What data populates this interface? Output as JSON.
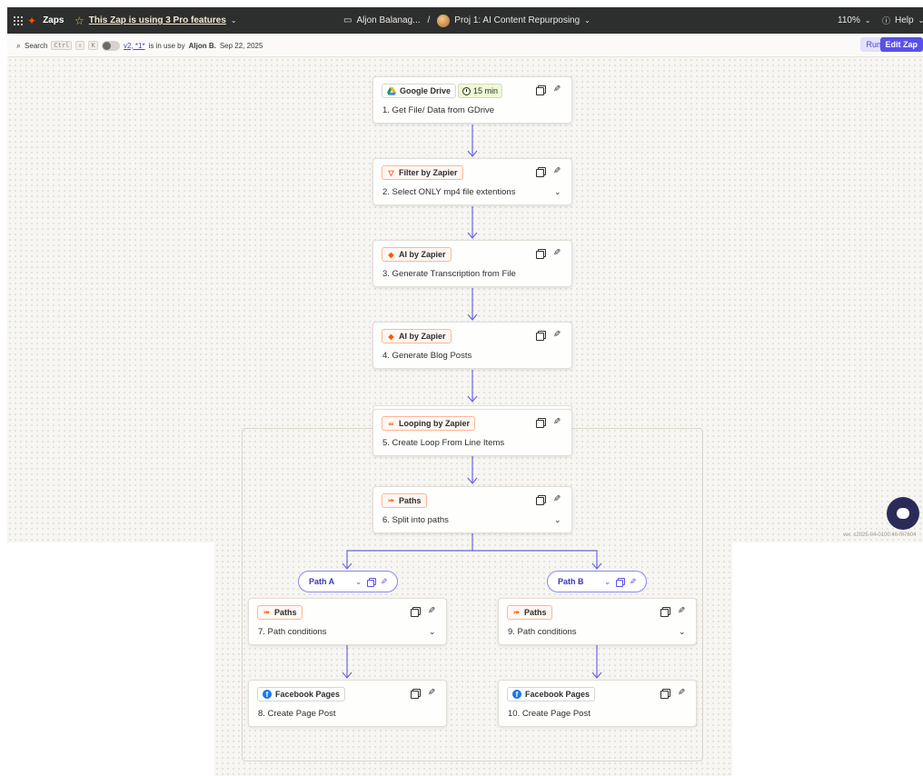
{
  "topbar": {
    "app_label": "Zaps",
    "pro_notice": "This Zap is using 3 Pro features",
    "folder": "Aljon Balanag...",
    "separator": "/",
    "zap_name": "Proj 1: AI Content Repurposing",
    "zoom": "110%",
    "help": "Help"
  },
  "subbar": {
    "search_label": "Search",
    "shortcut_ctrl": "Ctrl",
    "shortcut_shift": "⇧",
    "shortcut_key": "K",
    "version_link": "v2, *1*",
    "in_use_text": "is in use by",
    "user": "Aljon B.",
    "date": "Sep 22, 2025",
    "run_label": "Run",
    "edit_label": "Edit Zap"
  },
  "steps": [
    {
      "app": "Google Drive",
      "title": "1. Get File/ Data from GDrive",
      "badge": "15 min",
      "icon": "google-drive-icon"
    },
    {
      "app": "Filter by Zapier",
      "title": "2. Select ONLY mp4 file extentions",
      "icon": "filter-icon",
      "expandable": true
    },
    {
      "app": "AI by Zapier",
      "title": "3. Generate Transcription from File",
      "icon": "ai-sparkle-icon"
    },
    {
      "app": "AI by Zapier",
      "title": "4. Generate Blog Posts",
      "icon": "ai-sparkle-icon"
    },
    {
      "app": "Looping by Zapier",
      "title": "5. Create Loop From Line Items",
      "icon": "loop-icon"
    },
    {
      "app": "Paths",
      "title": "6. Split into paths",
      "icon": "paths-icon",
      "expandable": true
    }
  ],
  "paths": [
    {
      "name": "Path A",
      "steps": [
        {
          "app": "Paths",
          "title": "7. Path conditions",
          "icon": "paths-icon",
          "expandable": true
        },
        {
          "app": "Facebook Pages",
          "title": "8. Create Page Post",
          "icon": "facebook-icon"
        }
      ]
    },
    {
      "name": "Path B",
      "steps": [
        {
          "app": "Paths",
          "title": "9. Path conditions",
          "icon": "paths-icon",
          "expandable": true
        },
        {
          "app": "Facebook Pages",
          "title": "10. Create Page Post",
          "icon": "facebook-icon"
        }
      ]
    }
  ],
  "footer": {
    "version_string": "ver. c2025-04-0100:46-f67604"
  },
  "colors": {
    "accent": "#5851e8",
    "connector": "#6c66e6",
    "zapier_orange": "#ff4f00",
    "topbar_bg": "#2d2e2e",
    "canvas_bg": "#f7f6f3",
    "time_badge_bg": "#edf9d3"
  }
}
